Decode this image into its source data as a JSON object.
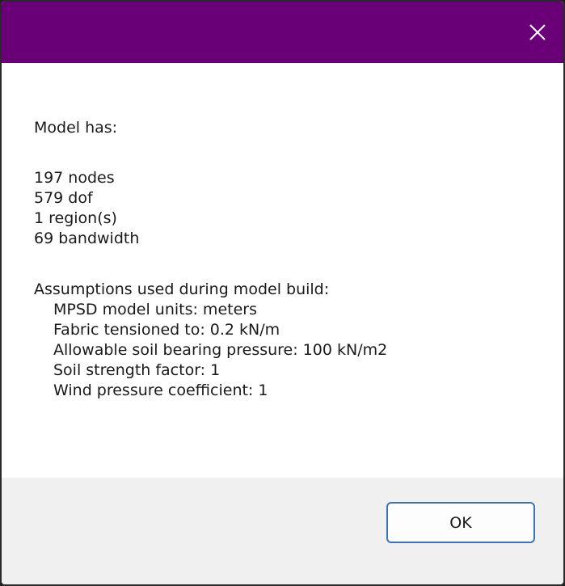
{
  "titlebar": {
    "color": "#6a0078",
    "close_icon": "close-icon"
  },
  "message": {
    "header": "Model has:",
    "stats": [
      "197 nodes",
      "579 dof",
      "1 region(s)",
      "69 bandwidth"
    ],
    "assumptions_header": "Assumptions used during model build:",
    "assumptions": [
      "MPSD model units: meters",
      "Fabric tensioned to: 0.2 kN/m",
      "Allowable soil bearing pressure: 100 kN/m2",
      "Soil strength factor: 1",
      "Wind pressure coefficient: 1"
    ]
  },
  "footer": {
    "ok_label": "OK",
    "button_border_color": "#3b73b9"
  }
}
